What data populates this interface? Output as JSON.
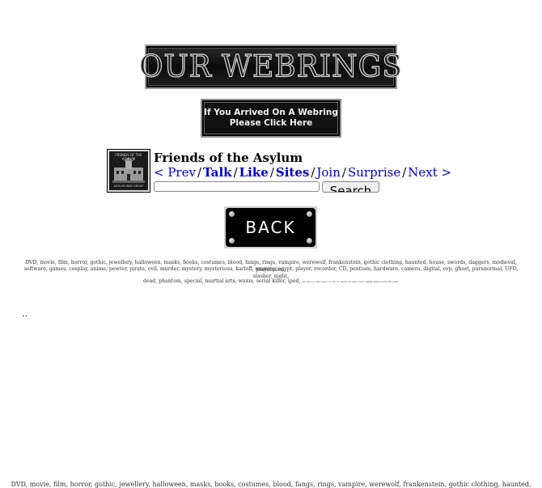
{
  "banner": {
    "word_left": "OUR",
    "word_right": "WEBRINGS"
  },
  "arrive_button": {
    "line1": "If You Arrived On A Webring",
    "line2": "Please Click Here"
  },
  "ring": {
    "thumb_caption": "FRIENDS OF THE ASYLUM",
    "thumb_footer": "ASYLUM WEB GROUP",
    "title": "Friends of the Asylum",
    "nav": {
      "prev": "< Prev",
      "talk": "Talk",
      "like": "Like",
      "sites": "Sites",
      "join": "Join",
      "surprise": "Surprise",
      "next": "Next >",
      "separator": "/"
    },
    "search_input_value": "",
    "search_button": "Search"
  },
  "back_button": {
    "label": "BACK"
  },
  "keywords": {
    "line1": "DVD, movie, film, horror, gothic, jewellery, halloween, masks, books, costumes, blood, fangs, rings, vampire, werewolf, frankenstein, gothic clothing, haunted, house, swords, daggers, medieval, playstation,",
    "line2": "software, games, cosplay, anime, pewter, pirate, evil, murder, mystery, mysterious, karloff, mummy, egypt, player, recorder, CD, pentium, hardware, camera, digital, evp, ghost, paranormal, UFO, slasher, night,",
    "line3": "dead, phantom, special, martial arts, wuxia, serial killer, ipod,",
    "line3_tiny": "ps2, xbox, pc, mp3, game, cd, dvd, rip, ghost, evil, dead, horror, slasher, anime, movie, film, gothic"
  },
  "spacer_dots": "..",
  "keywords_bottom": "DVD, movie, film, horror, gothic, jewellery, halloween, masks, books, costumes, blood, fangs, rings, vampire, werewolf, frankenstein, gothic clothing, haunted,"
}
